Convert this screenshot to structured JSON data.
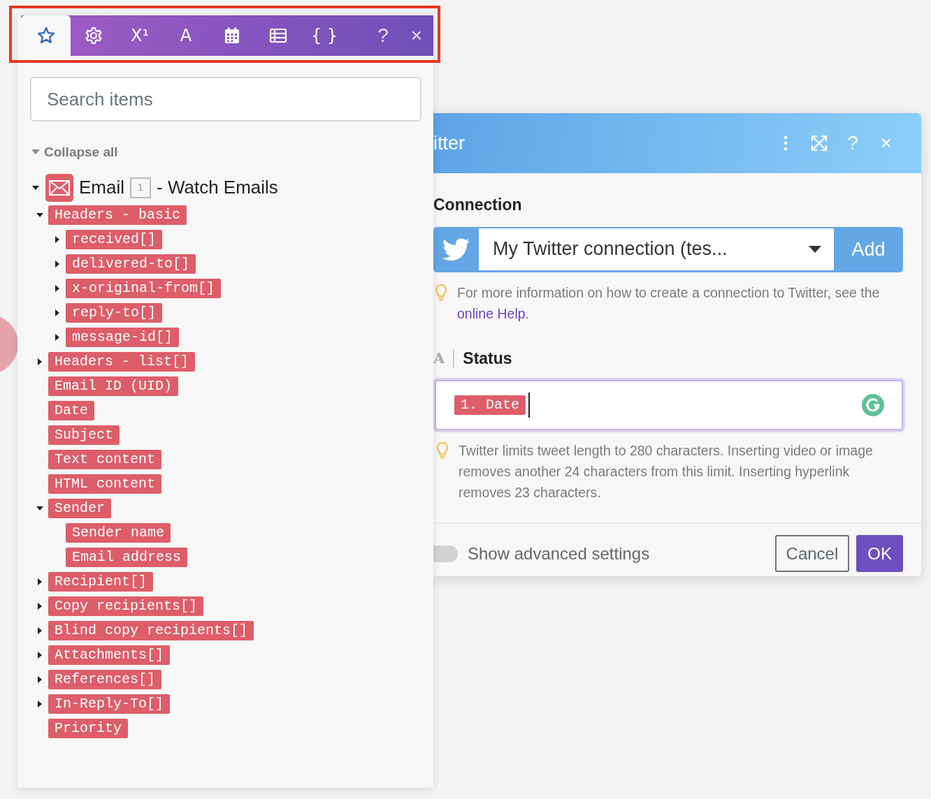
{
  "toolbar": {
    "tabs": [
      {
        "kind": "star",
        "selected": true
      },
      {
        "kind": "gear",
        "selected": false
      },
      {
        "kind": "glyph",
        "label": "X¹",
        "selected": false
      },
      {
        "kind": "glyph",
        "label": "A",
        "selected": false
      },
      {
        "kind": "calendar",
        "selected": false
      },
      {
        "kind": "table",
        "selected": false
      },
      {
        "kind": "glyph",
        "label": "{ }",
        "selected": false
      }
    ],
    "help": "?",
    "close": "×"
  },
  "search": {
    "placeholder": "Search items"
  },
  "collapse_all": "Collapse all",
  "tree": {
    "expanded": true,
    "module": "Email",
    "badge": "1",
    "title": "- Watch Emails",
    "children": [
      {
        "label": "Headers - basic",
        "kind": "collection",
        "expanded": true,
        "children": [
          {
            "label": "received[]",
            "kind": "collection",
            "expanded": false
          },
          {
            "label": "delivered-to[]",
            "kind": "collection",
            "expanded": false
          },
          {
            "label": "x-original-from[]",
            "kind": "collection",
            "expanded": false
          },
          {
            "label": "reply-to[]",
            "kind": "collection",
            "expanded": false
          },
          {
            "label": "message-id[]",
            "kind": "collection",
            "expanded": false
          }
        ]
      },
      {
        "label": "Headers - list[]",
        "kind": "collection",
        "expanded": false
      },
      {
        "label": "Email ID (UID)",
        "kind": "field"
      },
      {
        "label": "Date",
        "kind": "field"
      },
      {
        "label": "Subject",
        "kind": "field"
      },
      {
        "label": "Text content",
        "kind": "field"
      },
      {
        "label": "HTML content",
        "kind": "field"
      },
      {
        "label": "Sender",
        "kind": "collection",
        "expanded": true,
        "children": [
          {
            "label": "Sender name",
            "kind": "field"
          },
          {
            "label": "Email address",
            "kind": "field"
          }
        ]
      },
      {
        "label": "Recipient[]",
        "kind": "collection",
        "expanded": false
      },
      {
        "label": "Copy recipients[]",
        "kind": "collection",
        "expanded": false
      },
      {
        "label": "Blind copy recipients[]",
        "kind": "collection",
        "expanded": false
      },
      {
        "label": "Attachments[]",
        "kind": "collection",
        "expanded": false
      },
      {
        "label": "References[]",
        "kind": "collection",
        "expanded": false
      },
      {
        "label": "In-Reply-To[]",
        "kind": "collection",
        "expanded": false
      },
      {
        "label": "Priority",
        "kind": "field"
      }
    ]
  },
  "dialog": {
    "title": "itter",
    "help": "?",
    "close": "×",
    "connection": {
      "label": "Connection",
      "value": "My Twitter connection (tes...",
      "add": "Add",
      "hint_before": "For more information on how to create a connection to Twitter, see the",
      "hint_link": "online Help",
      "hint_after": "."
    },
    "status": {
      "type_glyph": "A",
      "label": "Status",
      "tokens": [
        "1. Date"
      ],
      "hint": "Twitter limits tweet length to 280 characters. Inserting video or image removes another 24 characters from this limit. Inserting hyperlink removes 23 characters."
    },
    "footer": {
      "advanced": {
        "label": "Show advanced settings",
        "on": false
      },
      "cancel": "Cancel",
      "ok": "OK"
    }
  }
}
